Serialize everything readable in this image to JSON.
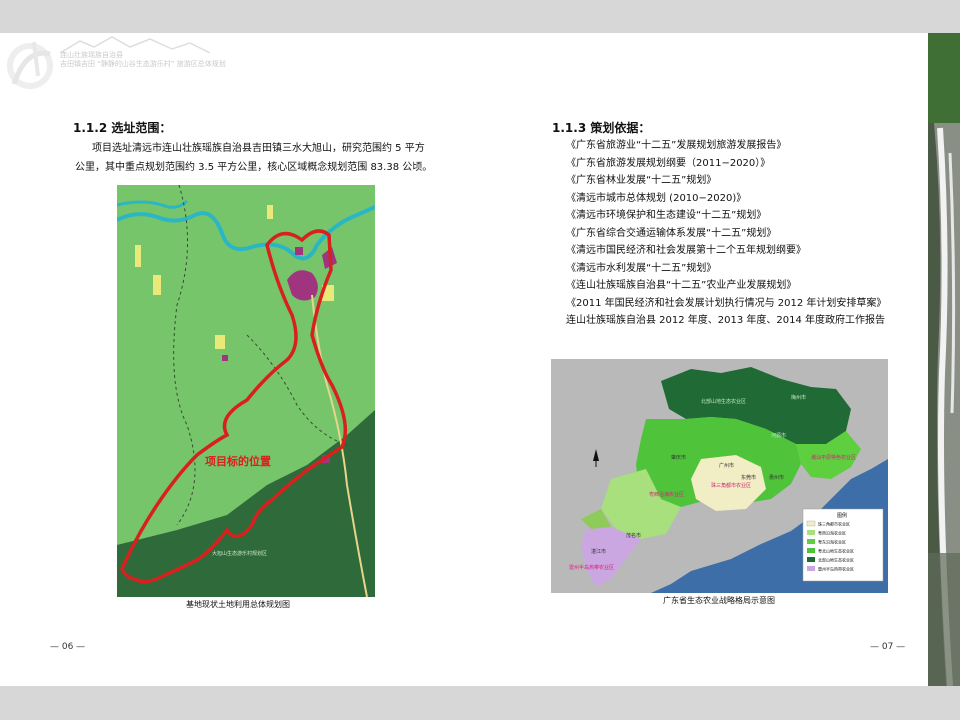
{
  "header": {
    "line1": "连山壮族瑶族自治县",
    "line2": "吉田镇吉田 “静静的山谷生态游乐村” 旅游区总体规划"
  },
  "left": {
    "heading": "1.1.2 选址范围：",
    "para_line1": "项目选址清远市连山壮族瑶族自治县吉田镇三水大旭山，研究范围约 5 平方",
    "para_line2": "公里，其中重点规划范围约 3.5 平方公里，核心区域概念规划范围 83.38 公顷。",
    "map_label": "项目标的位置",
    "map_small_label": "大旭山生态游乐村规划区",
    "caption": "基地现状土地利用总体规划图",
    "page_number": "— 06 —"
  },
  "right": {
    "heading": "1.1.3 策划依据：",
    "references": [
      "《广东省旅游业“十二五”发展规划旅游发展报告》",
      "《广东省旅游发展规划纲要（2011−2020）》",
      "《广东省林业发展“十二五”规划》",
      "《清远市城市总体规划 (2010−2020)》",
      "《清远市环境保护和生态建设“十二五”规划》",
      "《广东省综合交通运输体系发展“十二五”规划》",
      "《清远市国民经济和社会发展第十二个五年规划纲要》",
      "《清远市水利发展“十二五”规划》",
      "《连山壮族瑶族自治县“十二五”农业产业发展规划》",
      "《2011 年国民经济和社会发展计划执行情况与 2012 年计划安排草案》",
      " 连山壮族瑶族自治县 2012 年度、2013 年度、2014 年度政府工作报告"
    ],
    "map_labels": {
      "l1": "北部山地生态农业区",
      "l2": "梅州市",
      "l3": "河源市",
      "l4": "潮汕平原特色农业区",
      "l5": "广州市",
      "l6": "珠三角都市农业区",
      "l7": "粤西沿海农业区",
      "l8": "雷州半岛热带农业区",
      "l9": "肇庆市",
      "l10": "东莞市",
      "l11": "惠州市",
      "l12": "湛江市",
      "l13": "茂名市",
      "legend_title": "图例"
    },
    "legend_items": [
      "珠三角都市农业区",
      "粤西沿海农业区",
      "粤东沿海农业区",
      "粤北山地生态农业区",
      "北部山地生态农业区",
      "雷州半岛热带农业区"
    ],
    "caption": "广东省生态农业战略格局示意图",
    "page_number": "— 07 —"
  },
  "colors": {
    "route_red": "#d8211f",
    "river_cyan": "#28b7c7",
    "forest_green": "#2f6b3a",
    "land_green": "#7cc96a",
    "urban_magenta": "#a0347f"
  }
}
